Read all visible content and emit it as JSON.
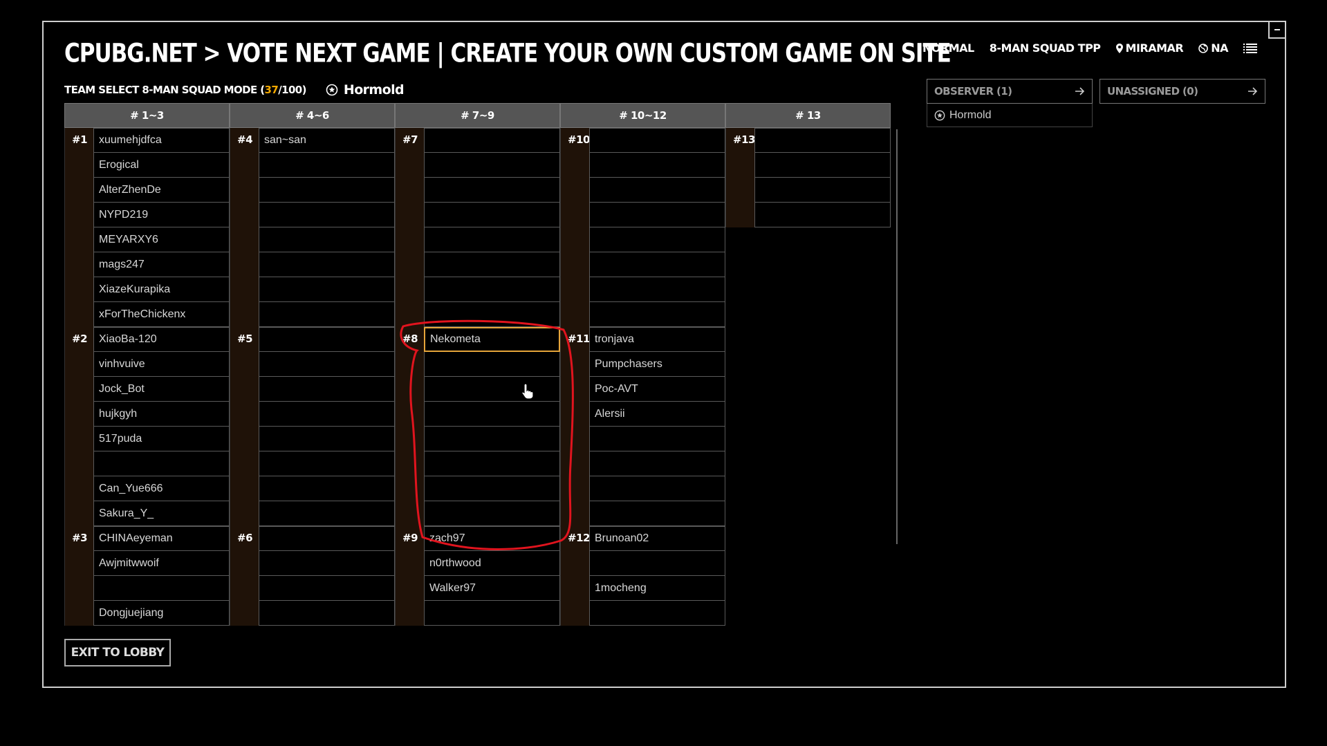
{
  "header": {
    "title": "CPUBG.NET > VOTE NEXT GAME | CREATE YOUR OWN CUSTOM GAME ON SITE",
    "mode": "NORMAL",
    "squad": "8-MAN SQUAD TPP",
    "map": "MIRAMAR",
    "region": "NA"
  },
  "subtitle": {
    "prefix": "TEAM SELECT 8-MAN SQUAD MODE (",
    "count": "37",
    "suffix": "/100)",
    "host": "Hormold"
  },
  "columns": [
    {
      "header": "# 1~3",
      "teams": [
        {
          "num": "#1",
          "players": [
            "xuumehjdfca",
            "Erogical",
            "AlterZhenDe",
            "NYPD219",
            "MEYARXY6",
            "mags247",
            "XiazeKurapika",
            "xForTheChickenx"
          ]
        },
        {
          "num": "#2",
          "players": [
            "XiaoBa-120",
            "vinhvuive",
            "Jock_Bot",
            "hujkgyh",
            "517puda",
            "",
            "Can_Yue666",
            "Sakura_Y_"
          ]
        },
        {
          "num": "#3",
          "players": [
            "CHINAeyeman",
            "Awjmitwwoif",
            "",
            "Dongjuejiang"
          ]
        }
      ]
    },
    {
      "header": "# 4~6",
      "teams": [
        {
          "num": "#4",
          "players": [
            "san~san",
            "",
            "",
            "",
            "",
            "",
            "",
            ""
          ]
        },
        {
          "num": "#5",
          "players": [
            "",
            "",
            "",
            "",
            "",
            "",
            "",
            ""
          ]
        },
        {
          "num": "#6",
          "players": [
            "",
            "",
            "",
            ""
          ]
        }
      ]
    },
    {
      "header": "# 7~9",
      "teams": [
        {
          "num": "#7",
          "players": [
            "",
            "",
            "",
            "",
            "",
            "",
            "",
            ""
          ]
        },
        {
          "num": "#8",
          "players": [
            "Nekometa",
            "",
            "",
            "",
            "",
            "",
            "",
            ""
          ]
        },
        {
          "num": "#9",
          "players": [
            "zach97",
            "n0rthwood",
            "Walker97",
            ""
          ]
        }
      ]
    },
    {
      "header": "# 10~12",
      "teams": [
        {
          "num": "#10",
          "players": [
            "",
            "",
            "",
            "",
            "",
            "",
            "",
            ""
          ]
        },
        {
          "num": "#11",
          "players": [
            "tronjava",
            "Pumpchasers",
            "Poc-AVT",
            "Alersii",
            "",
            "",
            "",
            ""
          ]
        },
        {
          "num": "#12",
          "players": [
            "Brunoan02",
            "",
            "1mocheng",
            ""
          ]
        }
      ]
    },
    {
      "header": "# 13",
      "teams": [
        {
          "num": "#13",
          "players": [
            "",
            "",
            "",
            ""
          ]
        }
      ]
    }
  ],
  "observer": {
    "label": "OBSERVER (1)",
    "players": [
      "Hormold"
    ]
  },
  "unassigned": {
    "label": "UNASSIGNED (0)"
  },
  "exit_label": "EXIT TO LOBBY",
  "colors": {
    "accent": "#f2a800",
    "selected_border": "#e6a53a",
    "annotation": "#e0141e"
  }
}
